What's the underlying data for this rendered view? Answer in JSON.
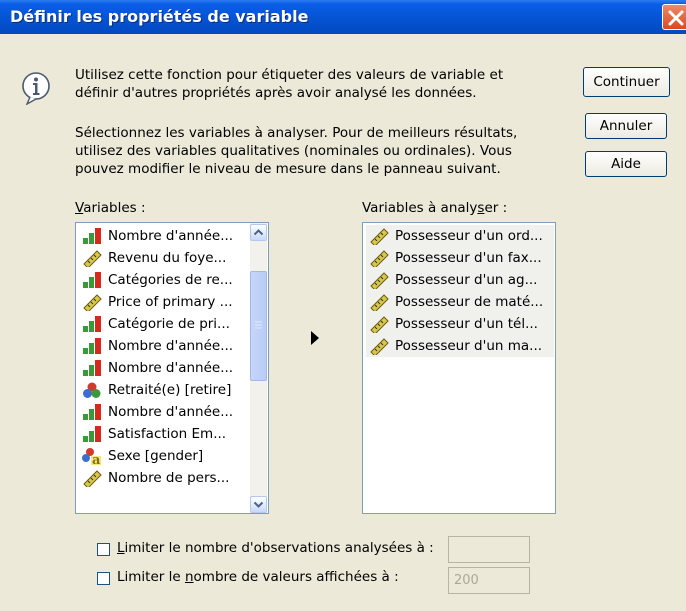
{
  "dialog": {
    "title": "Définir les propriétés de variable"
  },
  "info": {
    "line1": "Utilisez cette fonction pour étiqueter des valeurs de variable et",
    "line2": "définir d'autres propriétés après avoir analysé les données."
  },
  "instructions": {
    "line1": "Sélectionnez les variables à analyser. Pour de meilleurs résultats,",
    "line2": "utilisez des variables qualitatives (nominales ou ordinales). Vous",
    "line3": "pouvez modifier le niveau de mesure dans le panneau suivant."
  },
  "buttons": {
    "continue": "Continuer",
    "cancel": "Annuler",
    "help": "Aide"
  },
  "variables": {
    "label_pre": "",
    "label_underlined": "V",
    "label_post": "ariables :",
    "items": [
      {
        "label": "Nombre d'année...",
        "icon": "ordinal-icon"
      },
      {
        "label": "Revenu du foye...",
        "icon": "scale-icon"
      },
      {
        "label": "Catégories de re...",
        "icon": "ordinal-icon"
      },
      {
        "label": "Price of primary ...",
        "icon": "scale-icon"
      },
      {
        "label": "Catégorie de pri...",
        "icon": "ordinal-icon"
      },
      {
        "label": "Nombre d'année...",
        "icon": "ordinal-icon"
      },
      {
        "label": "Nombre d'année...",
        "icon": "ordinal-icon"
      },
      {
        "label": "Retraité(e) [retire]",
        "icon": "nominal-icon"
      },
      {
        "label": "Nombre d'année...",
        "icon": "ordinal-icon"
      },
      {
        "label": "Satisfaction Em...",
        "icon": "ordinal-icon"
      },
      {
        "label": "Sexe [gender]",
        "icon": "nominal-string-icon"
      },
      {
        "label": "Nombre de pers...",
        "icon": "scale-icon"
      }
    ]
  },
  "analyze": {
    "label_pre": "Variables à analy",
    "label_underlined": "s",
    "label_post": "er :",
    "items": [
      {
        "label": "Possesseur d'un ord...",
        "icon": "scale-icon"
      },
      {
        "label": "Possesseur d'un fax...",
        "icon": "scale-icon"
      },
      {
        "label": "Possesseur d'un ag...",
        "icon": "scale-icon"
      },
      {
        "label": "Possesseur de maté...",
        "icon": "scale-icon"
      },
      {
        "label": "Possesseur  d'un tél...",
        "icon": "scale-icon"
      },
      {
        "label": "Possesseur d'un ma...",
        "icon": "scale-icon"
      }
    ]
  },
  "options": {
    "limit_cases_pre": "",
    "limit_cases_underlined": "L",
    "limit_cases_post": "imiter le nombre d'observations analysées à :",
    "limit_cases_value": "",
    "limit_values_pre": "Limiter le ",
    "limit_values_underlined": "n",
    "limit_values_post": "ombre de valeurs affichées à :",
    "limit_values_value": "200"
  },
  "colors": {
    "titlebar": "#0553d4",
    "dialog_bg": "#ece9d8",
    "ordinal_bar_red": "#d62a1e",
    "ordinal_bar_green": "#3a9a3a",
    "ruler_yellow": "#d8c84a"
  }
}
